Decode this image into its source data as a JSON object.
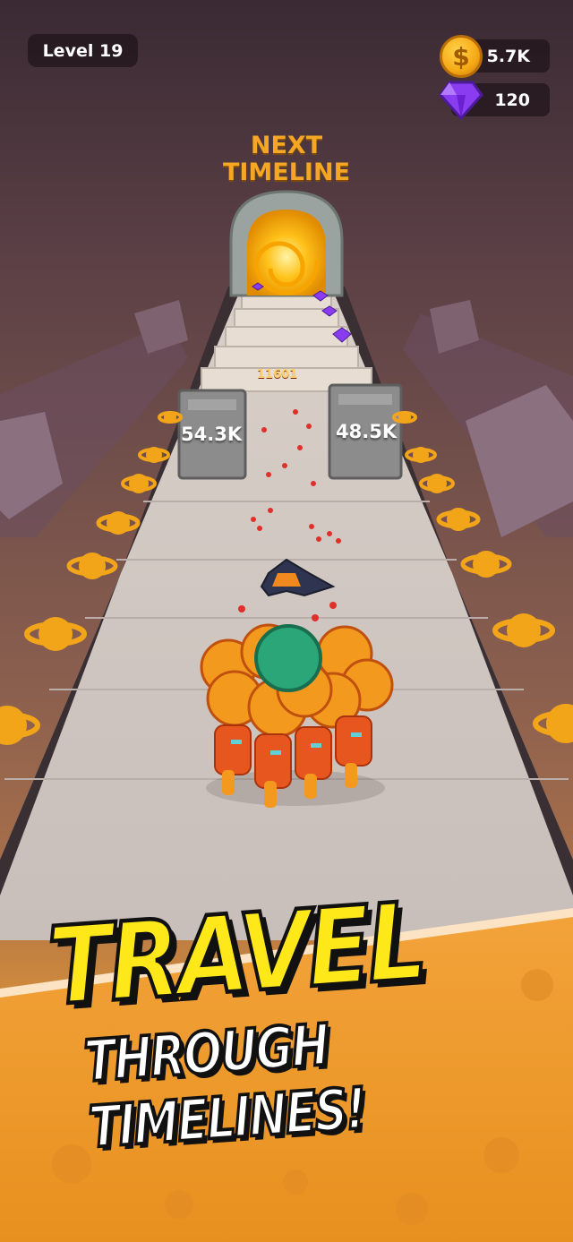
{
  "hud": {
    "level_label": "Level 19",
    "coins": "5.7K",
    "gems": "120",
    "coin_icon": "dollar-coin-icon",
    "gem_icon": "purple-gem-icon"
  },
  "portal": {
    "label": "NEXT\nTIMELINE"
  },
  "gates": {
    "left_value": "54.3K",
    "right_value": "48.5K"
  },
  "combat": {
    "hit_text": "11601"
  },
  "banner": {
    "title": "TRAVEL",
    "subtitle": "THROUGH TIMELINES!"
  },
  "colors": {
    "accent_yellow": "#ffe81a",
    "label_orange": "#f5a623",
    "crowd_orange": "#f39a1e",
    "gem_purple": "#8a3cf0"
  }
}
